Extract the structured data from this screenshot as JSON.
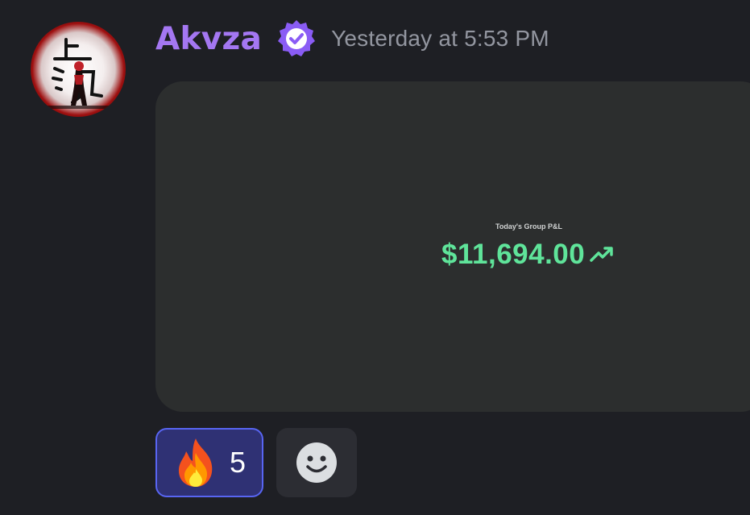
{
  "message": {
    "author": "Akvza",
    "author_color": "#a477f2",
    "verified_badge_icon": "verified-badge-icon",
    "timestamp": "Yesterday at 5:53 PM",
    "avatar_icon": "avatar-image"
  },
  "embed": {
    "label": "Today's Group P&L",
    "value": "$11,694.00",
    "value_color": "#5fe49a",
    "trend_icon": "trending-up-icon",
    "background": "#2c2e2e"
  },
  "reactions": [
    {
      "emoji_icon": "fire-emoji-icon",
      "count": "5",
      "active": true
    }
  ],
  "add_reaction_icon": "add-reaction-smiley-icon",
  "colors": {
    "background": "#1e1f24",
    "reaction_active_bg": "#2f3174",
    "reaction_active_border": "#5865f2"
  }
}
